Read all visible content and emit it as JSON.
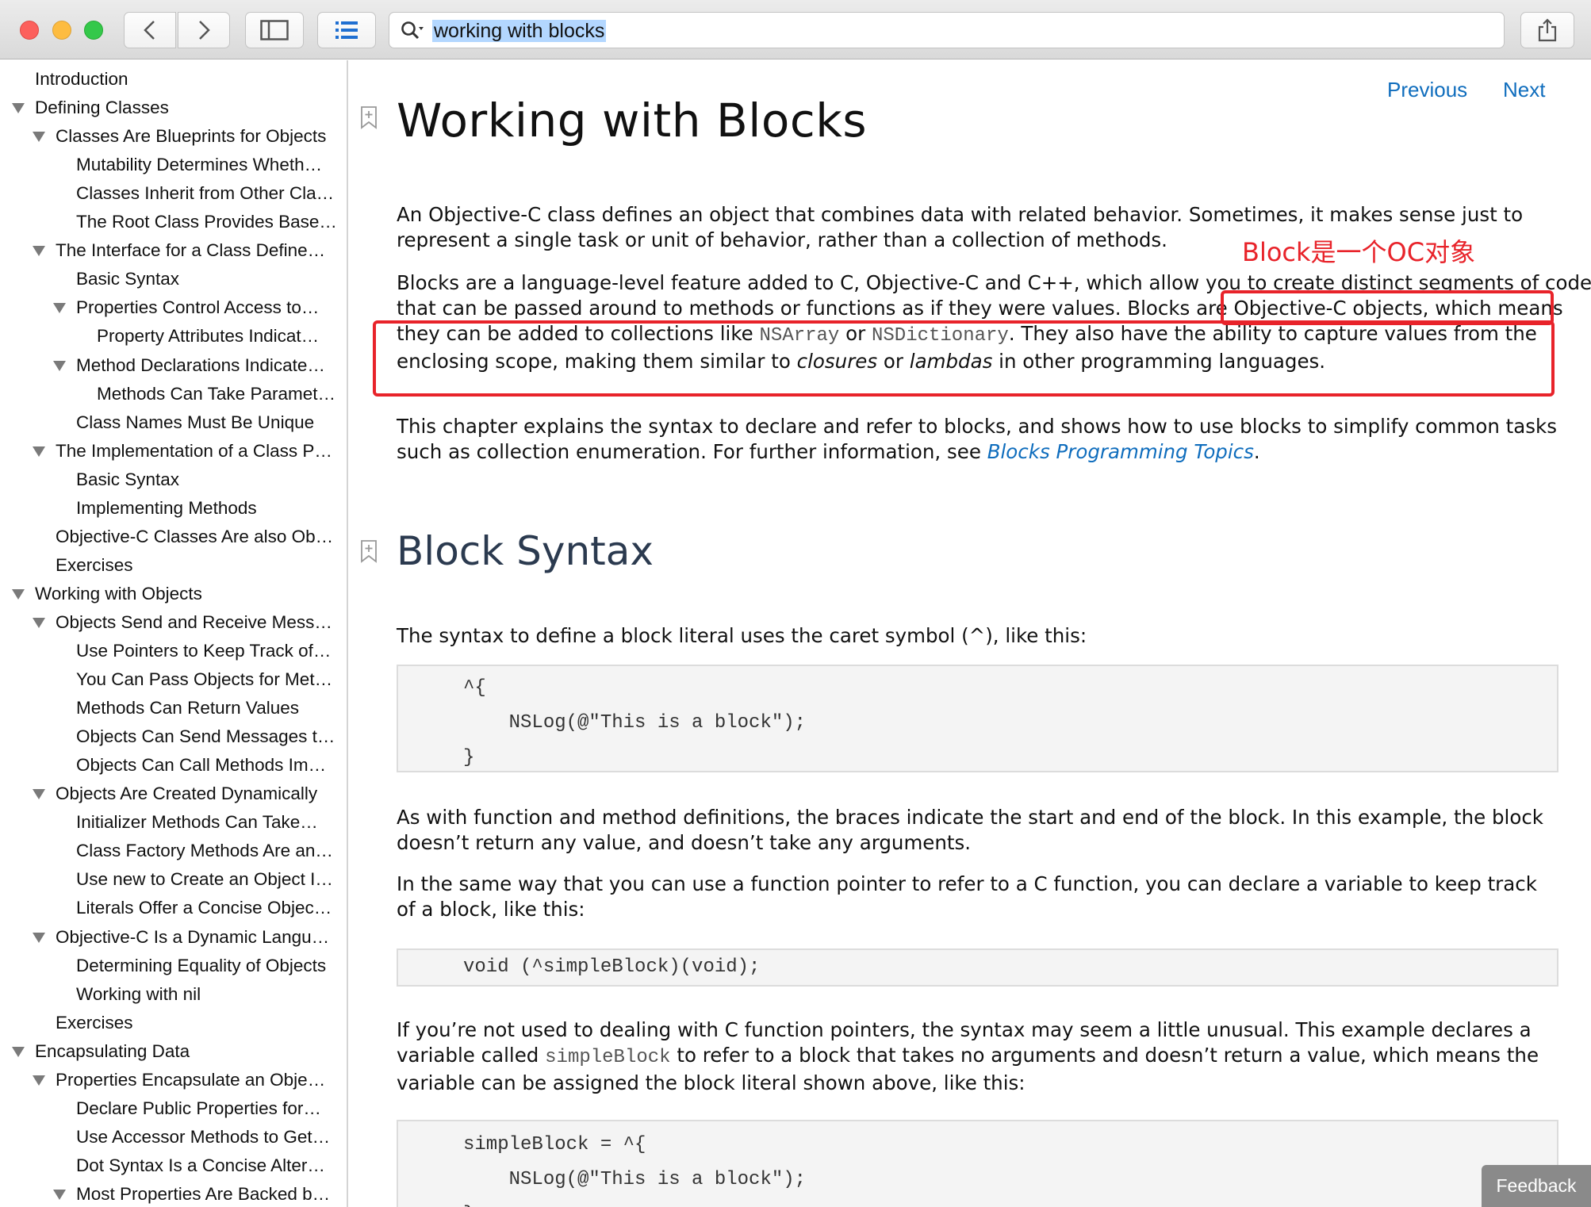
{
  "toolbar": {
    "search_query": "working with blocks"
  },
  "sidebar": {
    "items": [
      {
        "label": "Introduction",
        "level": 0,
        "expanded": null
      },
      {
        "label": "Defining Classes",
        "level": 0,
        "expanded": true
      },
      {
        "label": "Classes Are Blueprints for Objects",
        "level": 1,
        "expanded": true
      },
      {
        "label": "Mutability Determines Wheth…",
        "level": 2,
        "expanded": null
      },
      {
        "label": "Classes Inherit from Other Cla…",
        "level": 2,
        "expanded": null
      },
      {
        "label": "The Root Class Provides Base…",
        "level": 2,
        "expanded": null
      },
      {
        "label": "The Interface for a Class Define…",
        "level": 1,
        "expanded": true
      },
      {
        "label": "Basic Syntax",
        "level": 2,
        "expanded": null
      },
      {
        "label": "Properties Control Access to…",
        "level": 2,
        "expanded": true
      },
      {
        "label": "Property Attributes Indicat…",
        "level": 3,
        "expanded": null
      },
      {
        "label": "Method Declarations Indicate…",
        "level": 2,
        "expanded": true
      },
      {
        "label": "Methods Can Take Paramet…",
        "level": 3,
        "expanded": null
      },
      {
        "label": "Class Names Must Be Unique",
        "level": 2,
        "expanded": null
      },
      {
        "label": "The Implementation of a Class P…",
        "level": 1,
        "expanded": true
      },
      {
        "label": "Basic Syntax",
        "level": 2,
        "expanded": null
      },
      {
        "label": "Implementing Methods",
        "level": 2,
        "expanded": null
      },
      {
        "label": "Objective-C Classes Are also Ob…",
        "level": 1,
        "expanded": null
      },
      {
        "label": "Exercises",
        "level": 1,
        "expanded": null
      },
      {
        "label": "Working with Objects",
        "level": 0,
        "expanded": true
      },
      {
        "label": "Objects Send and Receive Mess…",
        "level": 1,
        "expanded": true
      },
      {
        "label": "Use Pointers to Keep Track of…",
        "level": 2,
        "expanded": null
      },
      {
        "label": "You Can Pass Objects for Met…",
        "level": 2,
        "expanded": null
      },
      {
        "label": "Methods Can Return Values",
        "level": 2,
        "expanded": null
      },
      {
        "label": "Objects Can Send Messages t…",
        "level": 2,
        "expanded": null
      },
      {
        "label": "Objects Can Call Methods Im…",
        "level": 2,
        "expanded": null
      },
      {
        "label": "Objects Are Created Dynamically",
        "level": 1,
        "expanded": true
      },
      {
        "label": "Initializer Methods Can Take…",
        "level": 2,
        "expanded": null
      },
      {
        "label": "Class Factory Methods Are an…",
        "level": 2,
        "expanded": null
      },
      {
        "label": "Use new to Create an Object I…",
        "level": 2,
        "expanded": null
      },
      {
        "label": "Literals Offer a Concise Objec…",
        "level": 2,
        "expanded": null
      },
      {
        "label": "Objective-C Is a Dynamic Langu…",
        "level": 1,
        "expanded": true
      },
      {
        "label": "Determining Equality of Objects",
        "level": 2,
        "expanded": null
      },
      {
        "label": "Working with nil",
        "level": 2,
        "expanded": null
      },
      {
        "label": "Exercises",
        "level": 1,
        "expanded": null
      },
      {
        "label": "Encapsulating Data",
        "level": 0,
        "expanded": true
      },
      {
        "label": "Properties Encapsulate an Obje…",
        "level": 1,
        "expanded": true
      },
      {
        "label": "Declare Public Properties for…",
        "level": 2,
        "expanded": null
      },
      {
        "label": "Use Accessor Methods to Get…",
        "level": 2,
        "expanded": null
      },
      {
        "label": "Dot Syntax Is a Concise Alter…",
        "level": 2,
        "expanded": null
      },
      {
        "label": "Most Properties Are Backed b…",
        "level": 2,
        "expanded": true
      }
    ]
  },
  "nav": {
    "previous": "Previous",
    "next": "Next"
  },
  "article": {
    "title": "Working with Blocks",
    "p1": "An Objective-C class defines an object that combines data with related behavior. Sometimes, it makes sense just to represent a single task or unit of behavior, rather than a collection of methods.",
    "p2_a": "Blocks are a language-level feature added to C, Objective-C and C++, which allow you to create distinct segments of code that can be passed around to methods or functions as if they were values. Blocks are Objective-C objects, which means they can be added to collections like ",
    "p2_code1": "NSArray",
    "p2_b": " or ",
    "p2_code2": "NSDictionary",
    "p2_c": ". They also have the ability to capture values from the enclosing scope, making them similar to ",
    "p2_em1": "closures",
    "p2_d": " or ",
    "p2_em2": "lambdas",
    "p2_e": " in other programming languages.",
    "p3_a": "This chapter explains the syntax to declare and refer to blocks, and shows how to use blocks to simplify common tasks such as collection enumeration. For further information, see ",
    "p3_link": "Blocks Programming Topics",
    "p3_b": ".",
    "section_title": "Block Syntax",
    "p4": "The syntax to define a block literal uses the caret symbol (^), like this:",
    "code1": [
      "^{",
      "    NSLog(@\"This is a block\");",
      "}"
    ],
    "p5": "As with function and method definitions, the braces indicate the start and end of the block. In this example, the block doesn’t return any value, and doesn’t take any arguments.",
    "p6": "In the same way that you can use a function pointer to refer to a C function, you can declare a variable to keep track of a block, like this:",
    "code2": [
      "void (^simpleBlock)(void);"
    ],
    "p7_a": "If you’re not used to dealing with C function pointers, the syntax may seem a little unusual. This example declares a variable called ",
    "p7_code": "simpleBlock",
    "p7_b": " to refer to a block that takes no arguments and doesn’t return a value, which means the variable can be assigned the block literal shown above, like this:",
    "code3": [
      "simpleBlock = ^{",
      "    NSLog(@\"This is a block\");",
      "};"
    ]
  },
  "annotation": {
    "label": "Block是一个OC对象",
    "color": "#e8232a"
  },
  "feedback_label": "Feedback",
  "colors": {
    "link": "#0f6dbd",
    "search_highlight": "#b3d7ff"
  }
}
